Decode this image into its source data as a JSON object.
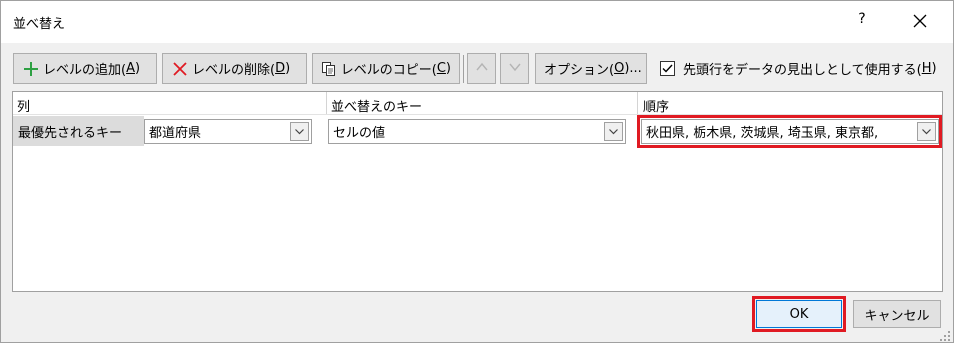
{
  "window": {
    "title": "並べ替え",
    "help_label": "?",
    "close_icon": "close-icon"
  },
  "toolbar": {
    "add_level": {
      "label": "レベルの追加(",
      "key": "A",
      "suffix": ")",
      "icon": "plus-icon",
      "icon_color": "#2ea043"
    },
    "delete_level": {
      "label": "レベルの削除(",
      "key": "D",
      "suffix": ")",
      "icon": "delete-x-icon",
      "icon_color": "#e01a22"
    },
    "copy_level": {
      "label": "レベルのコピー(",
      "key": "C",
      "suffix": ")",
      "icon": "copy-icon"
    },
    "move_up_icon": "chevron-up-icon",
    "move_down_icon": "chevron-down-icon",
    "options": {
      "label": "オプション(",
      "key": "O",
      "suffix": ")..."
    },
    "header_checkbox": {
      "label": "先頭行をデータの見出しとして使用する(",
      "key": "H",
      "suffix": ")",
      "checked": true
    }
  },
  "grid": {
    "headers": {
      "column": "列",
      "sort_on": "並べ替えのキー",
      "order": "順序"
    },
    "rows": [
      {
        "label": "最優先されるキー",
        "column_value": "都道府県",
        "sort_on_value": "セルの値",
        "order_value": "秋田県, 栃木県, 茨城県, 埼玉県, 東京都,"
      }
    ]
  },
  "buttons": {
    "ok": "OK",
    "cancel": "キャンセル"
  },
  "colors": {
    "highlight": "#e01a22",
    "ok_border": "#0078d7"
  }
}
